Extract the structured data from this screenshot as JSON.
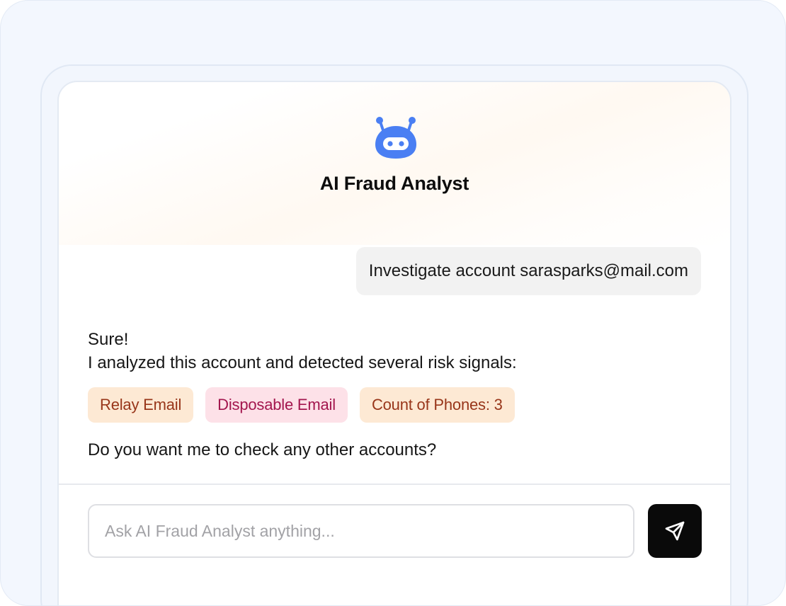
{
  "header": {
    "title": "AI Fraud Analyst",
    "bot_icon": "robot-icon",
    "brand_color": "#4a7ff3"
  },
  "messages": {
    "user": "Investigate account sarasparks@mail.com",
    "assistant_line1": "Sure!",
    "assistant_line2": "I analyzed this account and detected several risk signals:",
    "tags": [
      {
        "label": "Relay Email",
        "style": "orange"
      },
      {
        "label": "Disposable Email",
        "style": "pink"
      },
      {
        "label": "Count of Phones: 3",
        "style": "orange"
      }
    ],
    "followup": "Do you want me to check any other accounts?"
  },
  "composer": {
    "placeholder": "Ask AI Fraud Analyst anything...",
    "value": "",
    "send_icon": "send-icon"
  }
}
